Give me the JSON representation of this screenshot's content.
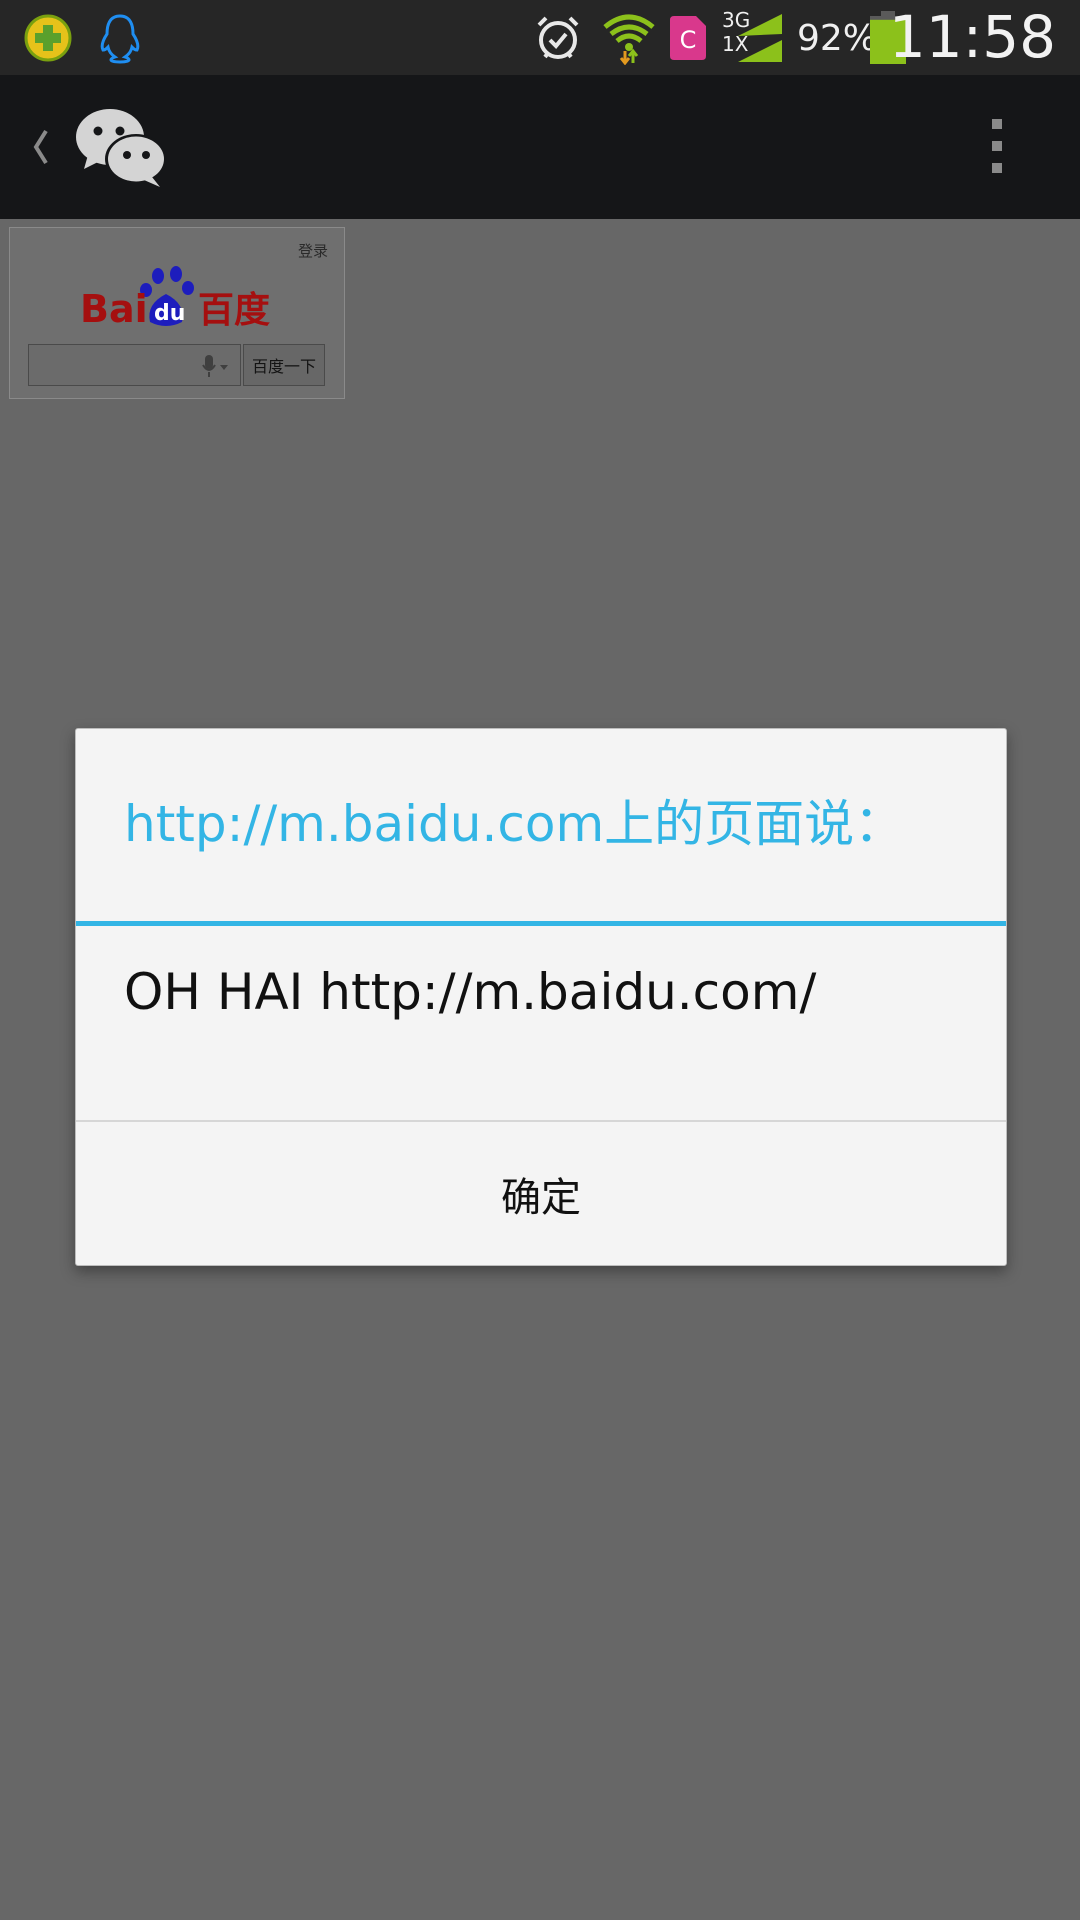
{
  "status_bar": {
    "time": "11:58",
    "battery_percent": "92%",
    "network_top": "3G",
    "network_bottom": "1X",
    "battery_level": 0.92,
    "icons": [
      "360-security-icon",
      "qq-icon",
      "alarm-clock-icon",
      "wifi-icon",
      "sim-card-c-icon",
      "signal-icon",
      "battery-icon"
    ]
  },
  "action_bar": {
    "back_icon": "back-chevron-icon",
    "app_icon": "wechat-icon",
    "menu_icon": "overflow-menu-icon"
  },
  "webpage": {
    "login_link": "登录",
    "logo_text": "Bai百度",
    "logo_du": "du",
    "search_button": "百度一下",
    "search_value": ""
  },
  "dialog": {
    "title": "http://m.baidu.com上的页面说：",
    "message": "OH HAI http://m.baidu.com/",
    "ok_button": "确定"
  },
  "colors": {
    "accent": "#33b5e5",
    "baidu_red": "#a50f0f",
    "baidu_blue": "#1d1dbd",
    "battery_green": "#8cc11b",
    "wifi_green": "#8cc11b"
  }
}
